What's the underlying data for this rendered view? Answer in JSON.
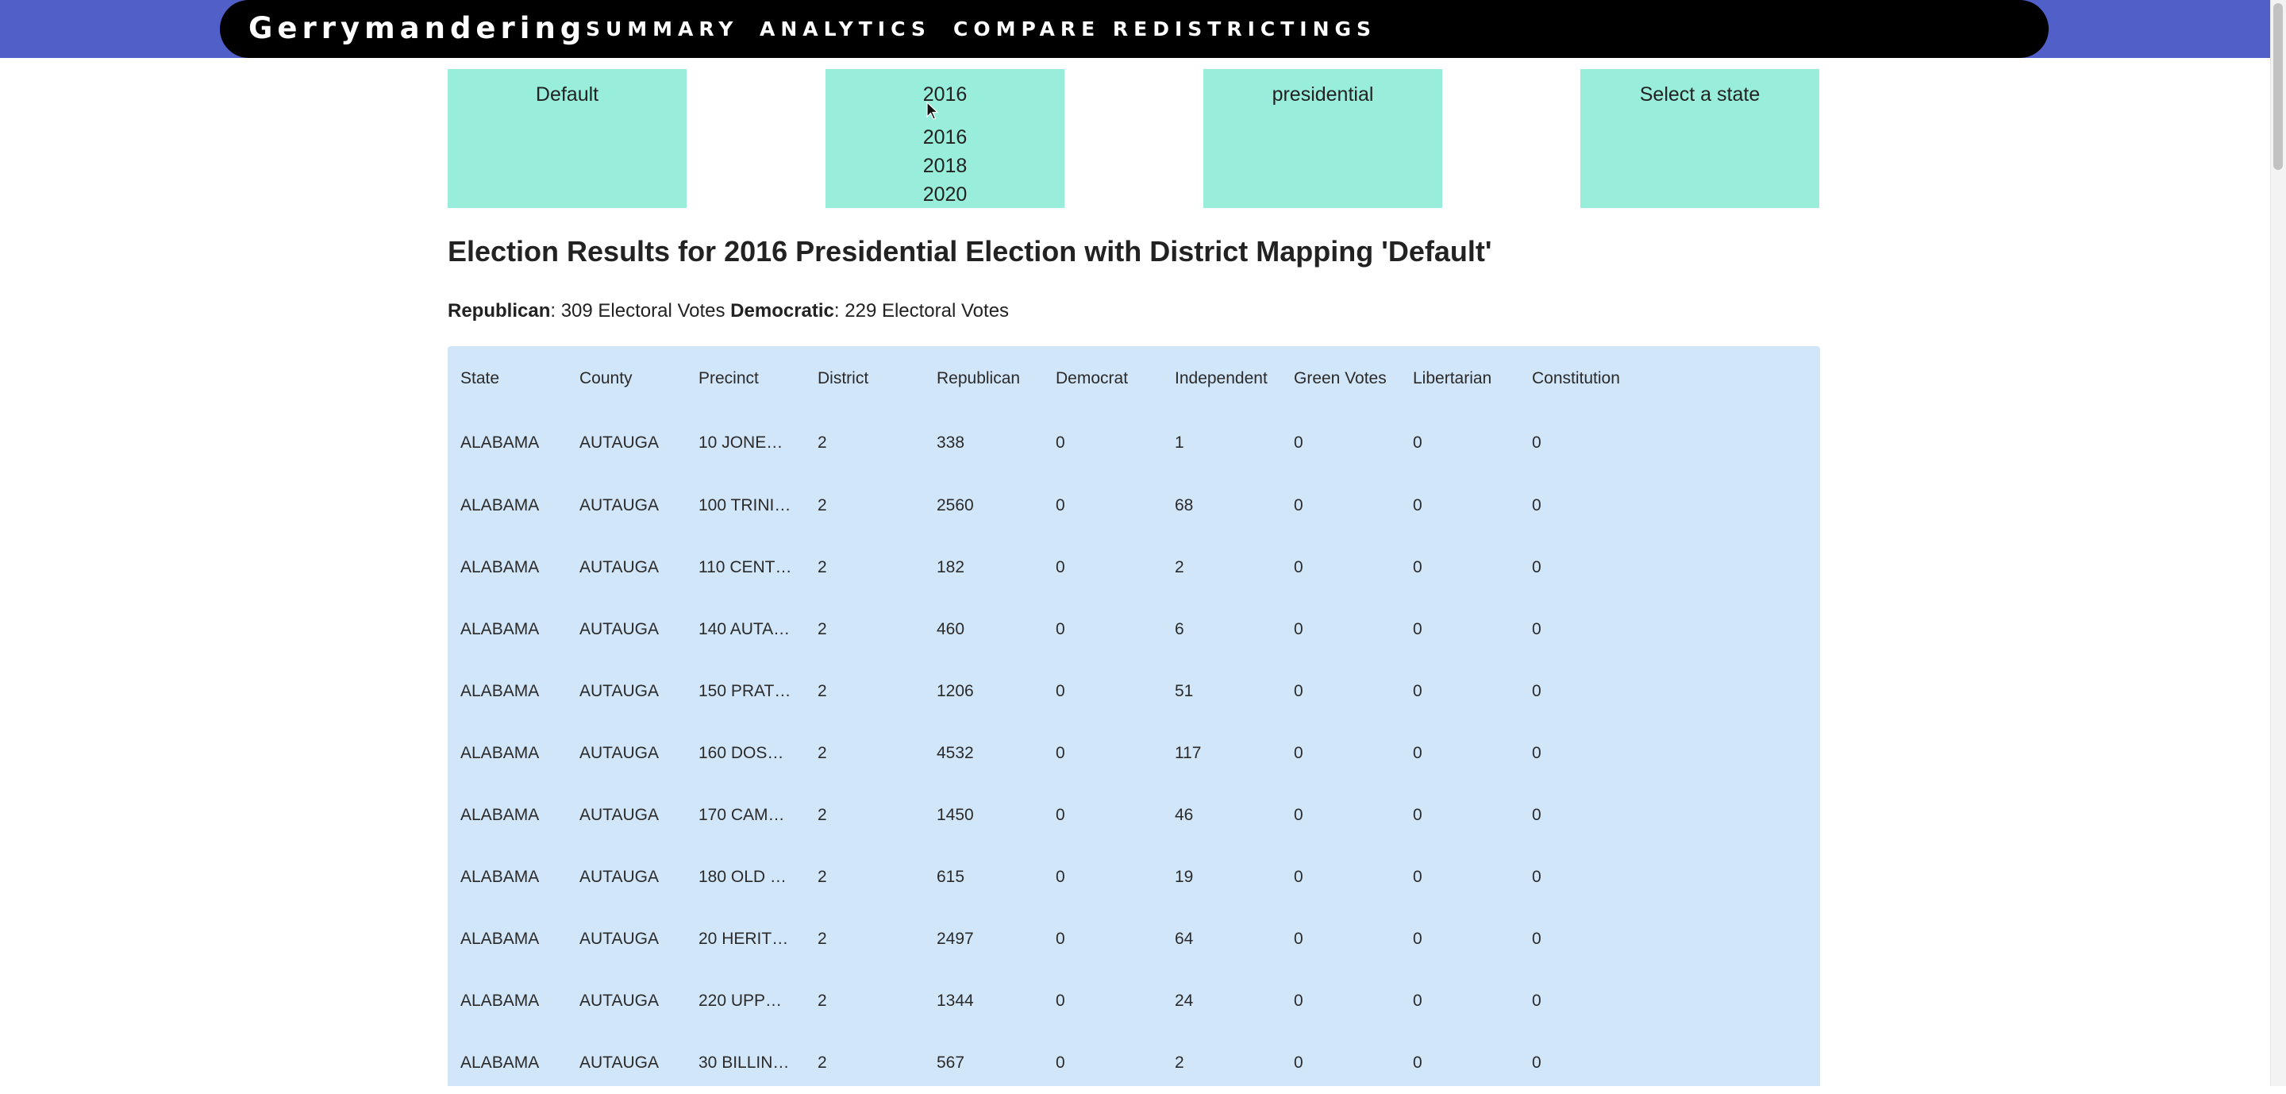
{
  "nav": {
    "brand": "Gerrymandering",
    "links": [
      "SUMMARY",
      "ANALYTICS",
      "COMPARE REDISTRICTINGS"
    ]
  },
  "selectors": {
    "mapping": "Default",
    "year": {
      "selected": "2016",
      "options": [
        "2016",
        "2018",
        "2020"
      ]
    },
    "election_type": "presidential",
    "state": "Select a state"
  },
  "title": "Election Results for 2016 Presidential Election with District Mapping 'Default'",
  "electoral": {
    "rep_label": "Republican",
    "rep_text": ": 309 Electoral Votes ",
    "dem_label": "Democratic",
    "dem_text": ": 229 Electoral Votes"
  },
  "table": {
    "headers": [
      "State",
      "County",
      "Precinct",
      "District",
      "Republican",
      "Democrat",
      "Independent",
      "Green Votes",
      "Libertarian",
      "Constitution"
    ],
    "rows": [
      [
        "ALABAMA",
        "AUTAUGA",
        "10 JONE…",
        "2",
        "338",
        "0",
        "1",
        "0",
        "0",
        "0"
      ],
      [
        "ALABAMA",
        "AUTAUGA",
        "100 TRINI…",
        "2",
        "2560",
        "0",
        "68",
        "0",
        "0",
        "0"
      ],
      [
        "ALABAMA",
        "AUTAUGA",
        "110 CENT…",
        "2",
        "182",
        "0",
        "2",
        "0",
        "0",
        "0"
      ],
      [
        "ALABAMA",
        "AUTAUGA",
        "140 AUTA…",
        "2",
        "460",
        "0",
        "6",
        "0",
        "0",
        "0"
      ],
      [
        "ALABAMA",
        "AUTAUGA",
        "150 PRAT…",
        "2",
        "1206",
        "0",
        "51",
        "0",
        "0",
        "0"
      ],
      [
        "ALABAMA",
        "AUTAUGA",
        "160 DOS…",
        "2",
        "4532",
        "0",
        "117",
        "0",
        "0",
        "0"
      ],
      [
        "ALABAMA",
        "AUTAUGA",
        "170 CAM…",
        "2",
        "1450",
        "0",
        "46",
        "0",
        "0",
        "0"
      ],
      [
        "ALABAMA",
        "AUTAUGA",
        "180 OLD …",
        "2",
        "615",
        "0",
        "19",
        "0",
        "0",
        "0"
      ],
      [
        "ALABAMA",
        "AUTAUGA",
        "20 HERIT…",
        "2",
        "2497",
        "0",
        "64",
        "0",
        "0",
        "0"
      ],
      [
        "ALABAMA",
        "AUTAUGA",
        "220 UPP…",
        "2",
        "1344",
        "0",
        "24",
        "0",
        "0",
        "0"
      ],
      [
        "ALABAMA",
        "AUTAUGA",
        "30 BILLIN…",
        "2",
        "567",
        "0",
        "2",
        "0",
        "0",
        "0"
      ]
    ]
  },
  "colors": {
    "nav_band": "#5060c8",
    "navbar": "#000000",
    "selector_bg": "#99eedb",
    "table_bg": "#d2e6fa"
  },
  "icons": {
    "cursor": "mouse-pointer-icon"
  }
}
